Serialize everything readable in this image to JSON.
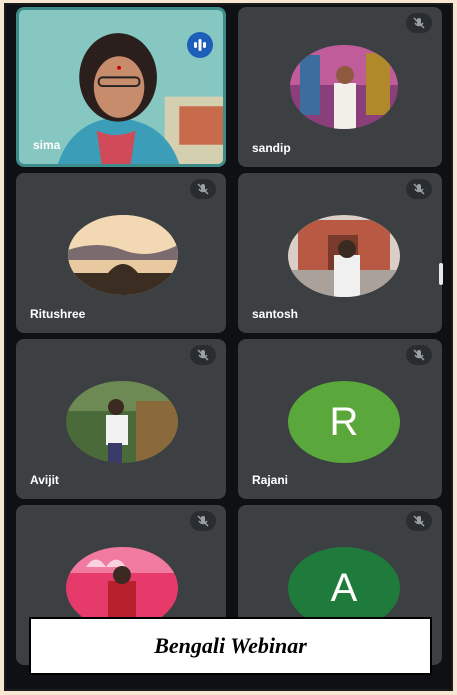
{
  "participants": [
    {
      "name": "sima",
      "state": "speaking"
    },
    {
      "name": "sandip",
      "state": "muted"
    },
    {
      "name": "Ritushree",
      "state": "muted"
    },
    {
      "name": "santosh",
      "state": "muted"
    },
    {
      "name": "Avijit",
      "state": "muted"
    },
    {
      "name": "Rajani",
      "state": "muted",
      "initial": "R"
    },
    {
      "name": "",
      "state": "muted"
    },
    {
      "name": "",
      "state": "muted",
      "initial": "A"
    }
  ],
  "caption": "Bengali Webinar",
  "colors": {
    "tile": "#3c4043",
    "self_border": "#3d8b8b",
    "speaking_badge": "#1d5fb8",
    "avatar_green": "#5aa83b",
    "avatar_darkgreen": "#1e7b3b"
  },
  "icons": [
    "mic-off-icon",
    "speaking-indicator-icon",
    "scrollbar"
  ]
}
